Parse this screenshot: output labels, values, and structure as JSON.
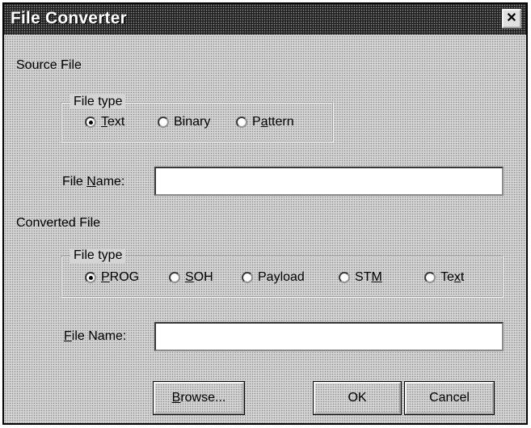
{
  "window": {
    "title": "File Converter",
    "close_glyph": "✕"
  },
  "source": {
    "section_label": "Source File",
    "filetype_legend": "File type",
    "options": [
      {
        "pre": "",
        "key": "T",
        "post": "ext",
        "selected": true
      },
      {
        "pre": "",
        "key": "",
        "post": "Binary",
        "selected": false
      },
      {
        "pre": "P",
        "key": "a",
        "post": "ttern",
        "selected": false
      }
    ],
    "filename_label_pre": "File ",
    "filename_label_key": "N",
    "filename_label_post": "ame:",
    "filename_value": ""
  },
  "converted": {
    "section_label": "Converted File",
    "filetype_legend": "File type",
    "options": [
      {
        "pre": "",
        "key": "P",
        "post": "ROG",
        "selected": true
      },
      {
        "pre": "",
        "key": "S",
        "post": "OH",
        "selected": false
      },
      {
        "pre": "",
        "key": "",
        "post": "Payload",
        "selected": false
      },
      {
        "pre": "ST",
        "key": "M",
        "post": "",
        "selected": false
      },
      {
        "pre": "Te",
        "key": "x",
        "post": "t",
        "selected": false
      }
    ],
    "filename_label_pre": "",
    "filename_label_key": "F",
    "filename_label_post": "ile Name:",
    "filename_value": ""
  },
  "buttons": {
    "browse": {
      "key": "B",
      "rest": "rowse..."
    },
    "ok": "OK",
    "cancel": "Cancel"
  }
}
